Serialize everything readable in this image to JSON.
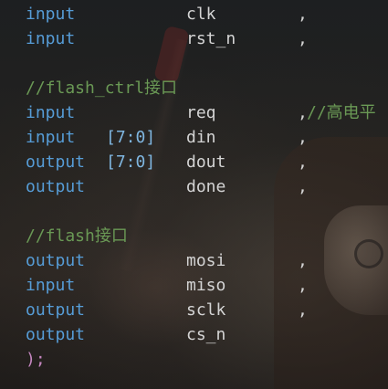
{
  "editor": {
    "lines": [
      {
        "dir": "input",
        "width": "",
        "name": "clk",
        "comma": ",",
        "comment": ""
      },
      {
        "dir": "input",
        "width": "",
        "name": "rst_n",
        "comma": ",",
        "comment": ""
      },
      {
        "section_comment": ""
      },
      {
        "section_comment": "//flash_ctrl接口"
      },
      {
        "dir": "input",
        "width": "",
        "name": "req",
        "comma": ",",
        "comment": "//高电平"
      },
      {
        "dir": "input",
        "width": "[7:0]",
        "name": "din",
        "comma": ",",
        "comment": ""
      },
      {
        "dir": "output",
        "width": "[7:0]",
        "name": "dout",
        "comma": ",",
        "comment": ""
      },
      {
        "dir": "output",
        "width": "",
        "name": "done",
        "comma": ",",
        "comment": ""
      },
      {
        "section_comment": ""
      },
      {
        "section_comment": "//flash接口"
      },
      {
        "dir": "output",
        "width": "",
        "name": "mosi",
        "comma": ",",
        "comment": ""
      },
      {
        "dir": "input",
        "width": "",
        "name": "miso",
        "comma": ",",
        "comment": ""
      },
      {
        "dir": "output",
        "width": "",
        "name": "sclk",
        "comma": ",",
        "comment": ""
      },
      {
        "dir": "output",
        "width": "",
        "name": "cs_n",
        "comma": "",
        "comment": ""
      },
      {
        "close": ");"
      }
    ]
  },
  "colors": {
    "keyword": "#569cd6",
    "identifier": "#d4d4d4",
    "comment": "#6a9955",
    "range": "#7fb6e0",
    "paren": "#c586c0"
  },
  "background": "anime-girl-with-guitar-wallpaper"
}
